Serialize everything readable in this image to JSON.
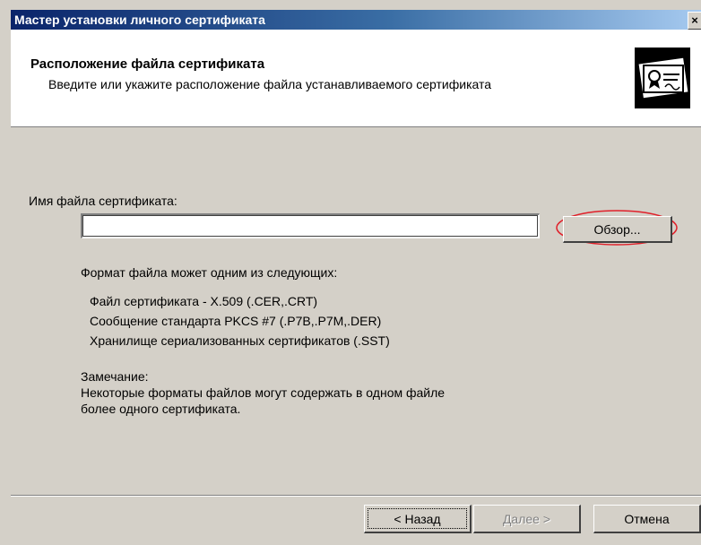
{
  "window": {
    "title": "Мастер установки личного сертификата",
    "close_glyph": "×"
  },
  "header": {
    "title": "Расположение файла сертификата",
    "subtitle": "Введите или укажите расположение файла устанавливаемого сертификата",
    "icon": "certificate-icon"
  },
  "form": {
    "file_label": "Имя файла сертификата:",
    "file_value": "",
    "browse_label": "Обзор..."
  },
  "info": {
    "formats_intro": "Формат файла может одним из следующих:",
    "formats": [
      "Файл сертификата - X.509 (.CER,.CRT)",
      "Сообщение стандарта PKCS #7 (.P7B,.P7M,.DER)",
      "Хранилище сериализованных сертификатов (.SST)"
    ],
    "note_title": "Замечание:",
    "note_lines": [
      "Некоторые форматы файлов могут содержать в одном файле",
      "более одного сертификата."
    ]
  },
  "footer": {
    "back_label": "< Назад",
    "next_label": "Далее >",
    "cancel_label": "Отмена"
  },
  "colors": {
    "title_bar_start": "#0a246a",
    "title_bar_end": "#a6caf0",
    "window_background": "#d4d0c8",
    "highlight_ellipse": "#e0202a"
  }
}
